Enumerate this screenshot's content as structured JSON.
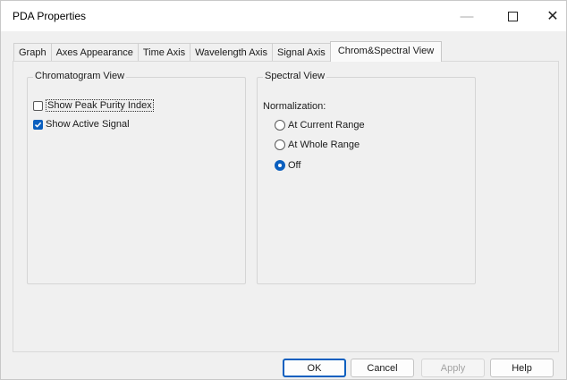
{
  "window": {
    "title": "PDA Properties"
  },
  "tabs": [
    {
      "label": "Graph"
    },
    {
      "label": "Axes Appearance"
    },
    {
      "label": "Time Axis"
    },
    {
      "label": "Wavelength Axis"
    },
    {
      "label": "Signal Axis"
    },
    {
      "label": "Chrom&Spectral View",
      "active": true
    }
  ],
  "chromatogram_view": {
    "title": "Chromatogram View",
    "show_peak_purity": {
      "label": "Show Peak Purity Index",
      "checked": false
    },
    "show_active_signal": {
      "label": "Show Active Signal",
      "checked": true
    }
  },
  "spectral_view": {
    "title": "Spectral View",
    "normalization_label": "Normalization:",
    "options": [
      {
        "label": "At Current Range",
        "selected": false
      },
      {
        "label": "At Whole Range",
        "selected": false
      },
      {
        "label": "Off",
        "selected": true
      }
    ]
  },
  "buttons": {
    "ok": "OK",
    "cancel": "Cancel",
    "apply": "Apply",
    "help": "Help"
  },
  "colors": {
    "accent": "#0a5fbf"
  }
}
